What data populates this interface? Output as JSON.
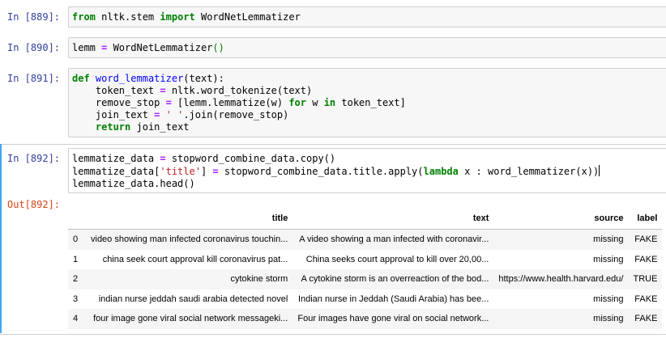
{
  "cells": [
    {
      "prompt": "In [889]:"
    },
    {
      "prompt": "In [890]:"
    },
    {
      "prompt": "In [891]:"
    },
    {
      "prompt": "In [892]:"
    }
  ],
  "code": {
    "c889": {
      "from": "from",
      "mod": " nltk.stem ",
      "import": "import",
      "name": " WordNetLemmatizer"
    },
    "c890": {
      "a": "lemm ",
      "eq": "=",
      "b": " WordNetLemmatizer",
      "paren": "()"
    },
    "c891": {
      "def": "def",
      "fname": "word_lemmatizer",
      "sig": "(text):",
      "l2a": "    token_text ",
      "eq": "=",
      "l2b": " nltk.word_tokenize(text)",
      "l3a": "    remove_stop ",
      "l3b": " [lemm.lemmatize(w) ",
      "for": "for",
      "l3c": " w ",
      "in": "in",
      "l3d": " token_text]",
      "l4a": "    join_text ",
      "l4str": "' '",
      "l4b": ".join(remove_stop)",
      "l5a": "    ",
      "return": "return",
      "l5b": " join_text"
    },
    "c892": {
      "l1a": "lemmatize_data ",
      "eq": "=",
      "l1b": " stopword_combine_data.copy()",
      "l2a": "lemmatize_data[",
      "l2str": "'title'",
      "l2b": "] ",
      "l2c": " stopword_combine_data.title.apply(",
      "lambda": "lambda",
      "l2d": " x : word_lemmatizer(x))",
      "l3": "lemmatize_data.head()"
    }
  },
  "output_prompt": "Out[892]:",
  "table": {
    "columns": [
      "",
      "title",
      "text",
      "source",
      "label"
    ],
    "rows": [
      [
        "0",
        "video showing man infected coronavirus touchin...",
        "A video showing a man infected with coronavir...",
        "missing",
        "FAKE"
      ],
      [
        "1",
        "china seek court approval kill coronavirus pat...",
        "China seeks court approval to kill over 20,00...",
        "missing",
        "FAKE"
      ],
      [
        "2",
        "cytokine storm",
        "A cytokine storm is an overreaction of the bod...",
        "https://www.health.harvard.edu/",
        "TRUE"
      ],
      [
        "3",
        "indian nurse jeddah saudi arabia detected novel",
        "Indian nurse in Jeddah (Saudi Arabia) has bee...",
        "missing",
        "FAKE"
      ],
      [
        "4",
        "four image gone viral social network messageki...",
        "Four images have gone viral on social network...",
        "missing",
        "FAKE"
      ]
    ]
  },
  "colors": {
    "accent": "#42a5f5",
    "in_prompt": "#303f9f",
    "out_prompt": "#d84315"
  }
}
